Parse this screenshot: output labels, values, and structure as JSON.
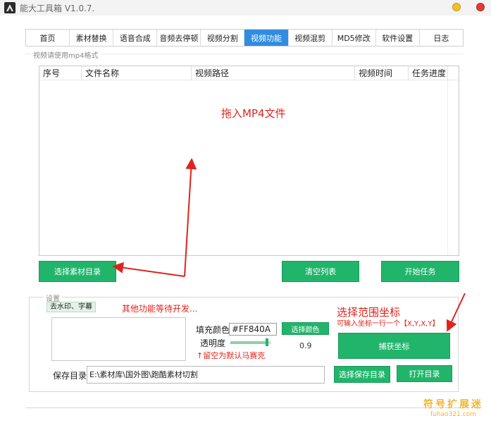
{
  "app": {
    "title": "能大工具箱 V1.0.7."
  },
  "tabs": [
    {
      "label": "首页",
      "active": false
    },
    {
      "label": "素材替换",
      "active": false
    },
    {
      "label": "语音合成",
      "active": false
    },
    {
      "label": "音频去停顿",
      "active": false
    },
    {
      "label": "视频分割",
      "active": false
    },
    {
      "label": "视频功能",
      "active": true
    },
    {
      "label": "视频混剪",
      "active": false
    },
    {
      "label": "MD5修改",
      "active": false
    },
    {
      "label": "软件设置",
      "active": false
    },
    {
      "label": "日志",
      "active": false
    }
  ],
  "video_hint": "视频请使用mp4格式",
  "table": {
    "columns": [
      "序号",
      "文件名称",
      "视频路径",
      "视频时间",
      "任务进度"
    ],
    "drop_text": "拖入MP4文件"
  },
  "actions": {
    "select_dir": "选择素材目录",
    "clear_list": "清空列表",
    "start_task": "开始任务"
  },
  "settings": {
    "title": "设置",
    "subtab": "去水印、字幕",
    "todo": "其他功能等待开发...",
    "fill_color_label": "填充颜色",
    "fill_color_value": "#FF840A",
    "choose_color": "选择颜色",
    "opacity_label": "透明度",
    "opacity_value": "0.9",
    "opacity_fraction": 0.9,
    "empty_note": "↑留空为默认马赛克",
    "pick_title": "选择范围坐标",
    "pick_hint": "可输入坐标一行一个【X,Y,X,Y】",
    "capture_coords": "捕获坐标",
    "save_dir_label": "保存目录",
    "save_dir_value": "E:\\素材库\\国外图\\跑酷素材切割",
    "choose_save_dir": "选择保存目录",
    "open_dir": "打开目录"
  },
  "watermark": {
    "main": "符号扩展迷",
    "sub": "fuhao321.com"
  },
  "colors": {
    "accent_blue": "#2e8de0",
    "button_green": "#21b56b",
    "annotation_red": "#e0231c",
    "watermark_gold": "#f2b52a"
  }
}
